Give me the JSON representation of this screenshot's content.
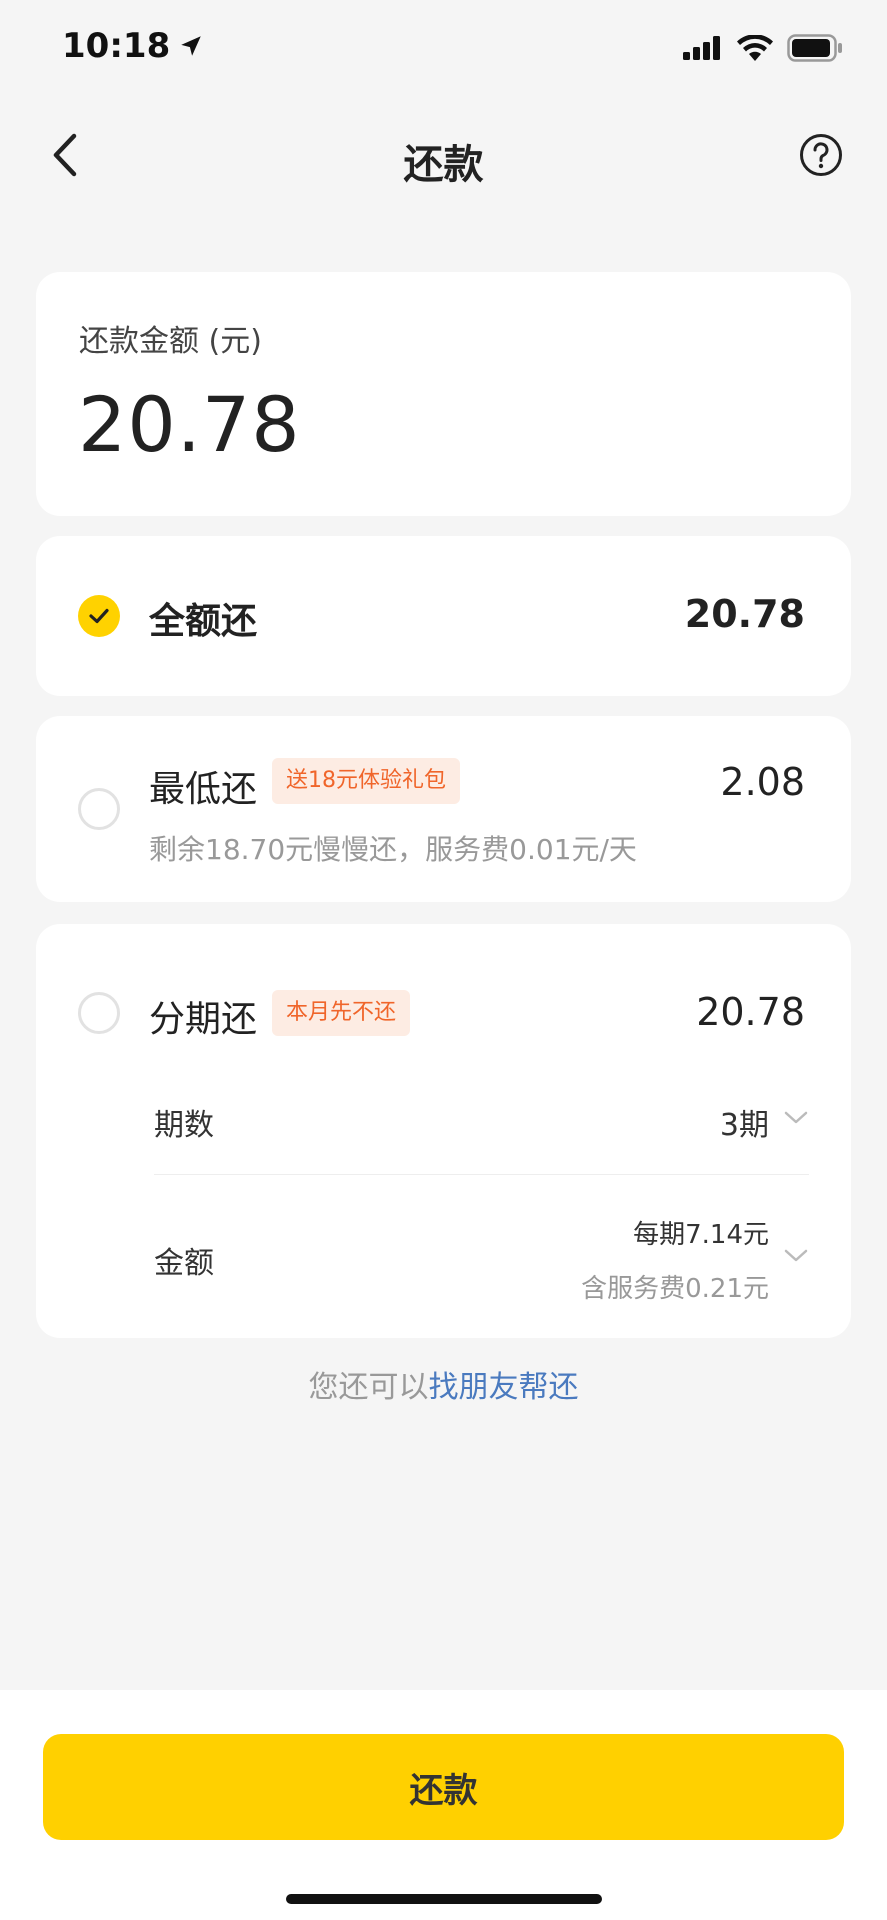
{
  "status_bar": {
    "time": "10:18"
  },
  "nav": {
    "title": "还款"
  },
  "amount_card": {
    "label": "还款金额 (元)",
    "value": "20.78"
  },
  "options": {
    "full": {
      "title": "全额还",
      "value": "20.78",
      "selected": true
    },
    "minimum": {
      "title": "最低还",
      "tag": "送18元体验礼包",
      "value": "2.08",
      "subtitle": "剩余18.70元慢慢还，服务费0.01元/天",
      "selected": false
    },
    "installment": {
      "title": "分期还",
      "tag": "本月先不还",
      "value": "20.78",
      "selected": false,
      "periods_label": "期数",
      "periods_value": "3期",
      "amount_label": "金额",
      "per_period": "每期7.14元",
      "fee_note": "含服务费0.21元"
    }
  },
  "friend_help": {
    "prefix": "您还可以",
    "link": "找朋友帮还"
  },
  "pay_button": {
    "label": "还款"
  },
  "colors": {
    "accent": "#ffd200",
    "tag_bg": "#fdece3",
    "tag_text": "#f0652a",
    "link": "#4a7abf"
  }
}
